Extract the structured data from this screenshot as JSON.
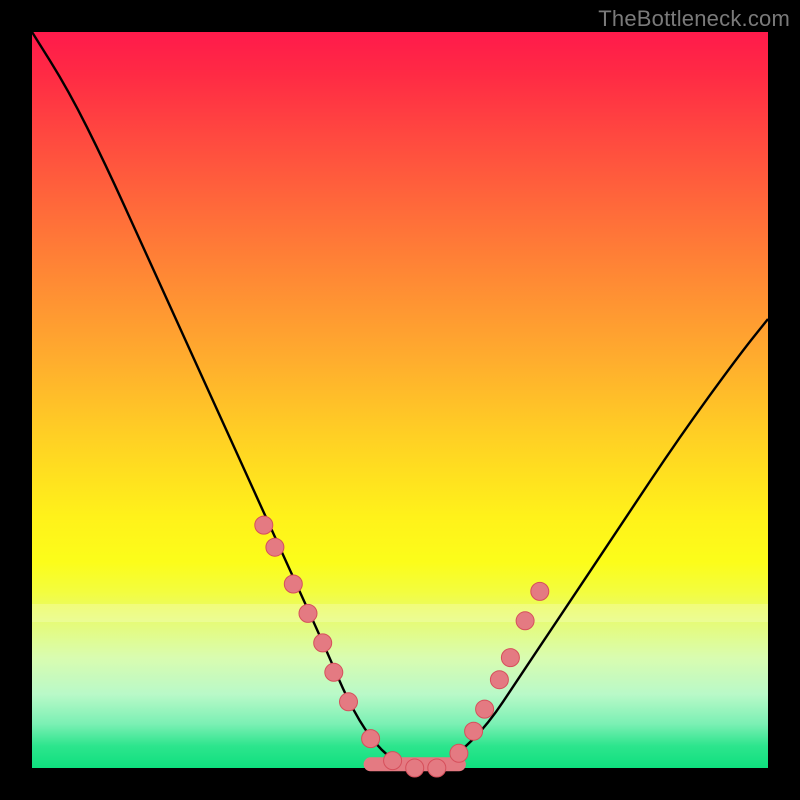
{
  "watermark": "TheBottleneck.com",
  "chart_data": {
    "type": "line",
    "title": "",
    "xlabel": "",
    "ylabel": "",
    "xlim": [
      0,
      100
    ],
    "ylim": [
      0,
      100
    ],
    "series": [
      {
        "name": "bottleneck-curve",
        "x": [
          0,
          5,
          10,
          15,
          20,
          25,
          30,
          35,
          40,
          43,
          46,
          49,
          52,
          55,
          58,
          62,
          66,
          72,
          80,
          88,
          96,
          100
        ],
        "y": [
          100,
          92,
          82,
          71,
          60,
          49,
          38,
          27,
          16,
          9,
          4,
          1,
          0,
          0,
          2,
          6,
          12,
          21,
          33,
          45,
          56,
          61
        ]
      }
    ],
    "markers": {
      "name": "highlighted-points",
      "x": [
        31.5,
        33,
        35.5,
        37.5,
        39.5,
        41,
        43,
        46,
        49,
        52,
        55,
        58,
        60,
        61.5,
        63.5,
        65,
        67,
        69
      ],
      "y": [
        33,
        30,
        25,
        21,
        17,
        13,
        9,
        4,
        1,
        0,
        0,
        2,
        5,
        8,
        12,
        15,
        20,
        24
      ]
    },
    "trough": {
      "x": [
        46,
        58
      ],
      "y": 0.5
    },
    "background": "rainbow-vertical-gradient"
  }
}
